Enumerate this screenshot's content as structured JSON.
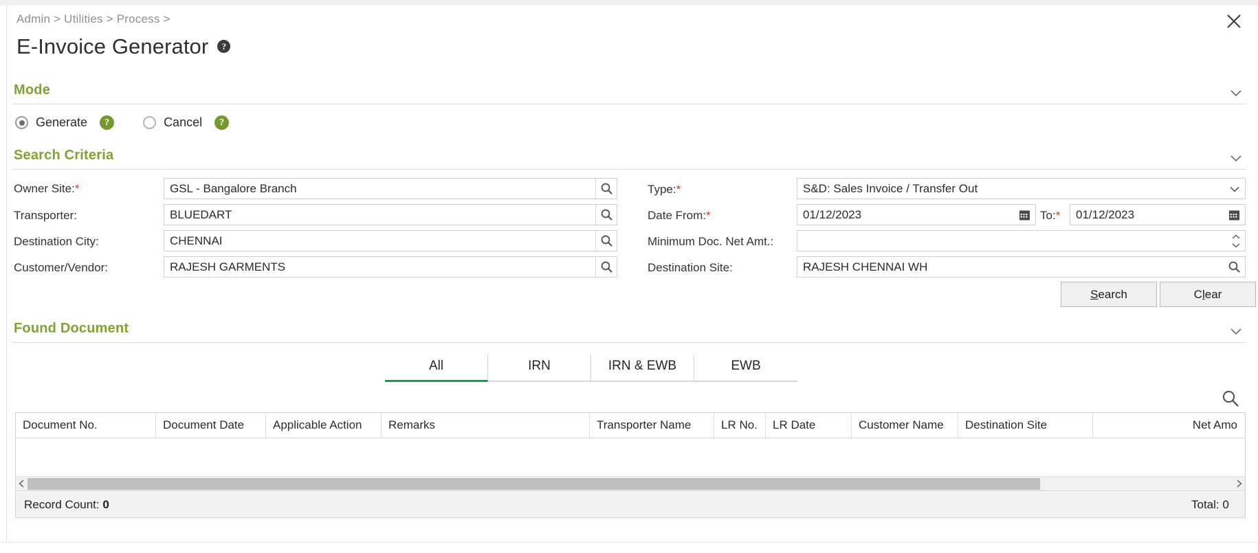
{
  "header": {
    "breadcrumb": "Admin > Utilities > Process >",
    "title": "E-Invoice Generator",
    "title_help": "?",
    "close_icon": "close-icon"
  },
  "mode_section": {
    "title": "Mode",
    "options": [
      {
        "label": "Generate",
        "selected": true,
        "help": "?"
      },
      {
        "label": "Cancel",
        "selected": false,
        "help": "?"
      }
    ]
  },
  "search_criteria": {
    "title": "Search Criteria",
    "left_fields": [
      {
        "label": "Owner Site:",
        "required": true,
        "value": "GSL - Bangalore Branch",
        "widget": "lookup"
      },
      {
        "label": "Transporter:",
        "required": false,
        "value": "BLUEDART",
        "widget": "lookup"
      },
      {
        "label": "Destination City:",
        "required": false,
        "value": "CHENNAI",
        "widget": "lookup"
      },
      {
        "label": "Customer/Vendor:",
        "required": false,
        "value": "RAJESH GARMENTS",
        "widget": "lookup"
      }
    ],
    "right_fields": [
      {
        "label": "Type:",
        "required": true,
        "value": "S&D: Sales Invoice / Transfer Out",
        "widget": "dropdown"
      },
      {
        "label": "Date From:",
        "required": true,
        "value": "01/12/2023",
        "widget": "date"
      },
      {
        "label": "Minimum Doc. Net Amt.:",
        "required": false,
        "value": "",
        "widget": "spinner"
      },
      {
        "label": "Destination Site:",
        "required": false,
        "value": "RAJESH CHENNAI WH",
        "widget": "lookup"
      }
    ],
    "date_to": {
      "label": "To:",
      "required": true,
      "value": "01/12/2023",
      "widget": "date"
    },
    "buttons": [
      {
        "label": "Search",
        "accel": "S"
      },
      {
        "label": "Clear",
        "accel": "l"
      }
    ]
  },
  "found_document": {
    "title": "Found Document",
    "tabs": [
      {
        "label": "All",
        "active": true
      },
      {
        "label": "IRN",
        "active": false
      },
      {
        "label": "IRN & EWB",
        "active": false
      },
      {
        "label": "EWB",
        "active": false
      }
    ],
    "grid_search_icon": "search-icon",
    "columns": [
      "Document No.",
      "Document Date",
      "Applicable Action",
      "Remarks",
      "Transporter Name",
      "LR No.",
      "LR Date",
      "Customer Name",
      "Destination Site",
      "Net Amo"
    ],
    "rows": [],
    "footer": {
      "record_count_label": "Record Count:",
      "record_count_value": "0",
      "total_label": "Total: 0"
    }
  },
  "colors": {
    "section_heading": "#7fa32f",
    "help_badge_green": "#74992e",
    "active_tab_underline": "#16a34a",
    "required_asterisk": "#d03b2f"
  }
}
